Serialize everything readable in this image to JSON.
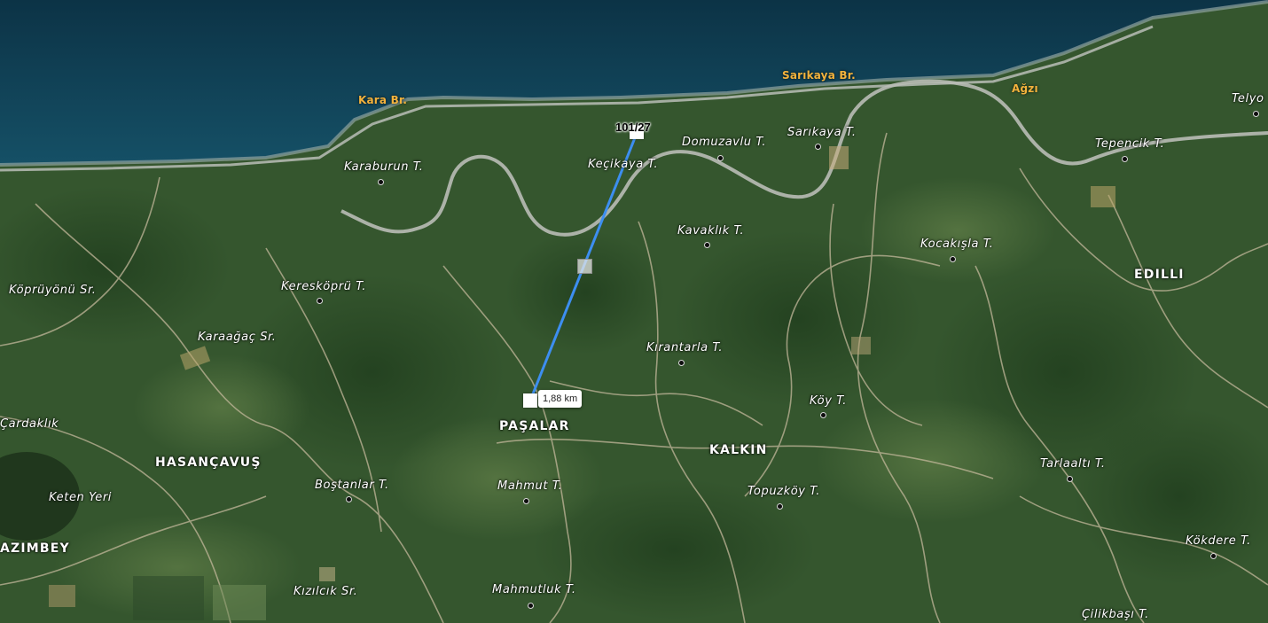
{
  "map": {
    "type": "satellite",
    "colors": {
      "sea": "#0f3a4f",
      "land": "#35562e",
      "road": "#b9bdb6",
      "measure_line": "#3d8ef0",
      "coast_label": "#f3b23c"
    }
  },
  "measurement": {
    "parcel_label": "101/27",
    "distance_label": "1,88 km"
  },
  "coast_labels": [
    "Kara Br.",
    "Sarıkaya Br.",
    "Ağzı"
  ],
  "villages": [
    "PAŞALAR",
    "KALKIN",
    "HASANÇAVUŞ",
    "EDILLI",
    "AZIMBEY"
  ],
  "hills": [
    "Karaburun T.",
    "Keçikaya T.",
    "Domuzavlu T.",
    "Sarıkaya T.",
    "Tepencik T.",
    "Telyo",
    "Kavaklık T.",
    "Kocakışla T.",
    "Keresköprü T.",
    "Kırantarla T.",
    "Köy T.",
    "Mahmut T.",
    "Boştanlar T.",
    "Topuzköy T.",
    "Tarlaaltı T.",
    "Kökdere T.",
    "Mahmutluk T.",
    "Çilikbaşı T."
  ],
  "localities": [
    "Köprüyönü Sr.",
    "Karaağaç Sr.",
    "Çardaklık",
    "Keten Yeri",
    "Kızılcık Sr."
  ]
}
